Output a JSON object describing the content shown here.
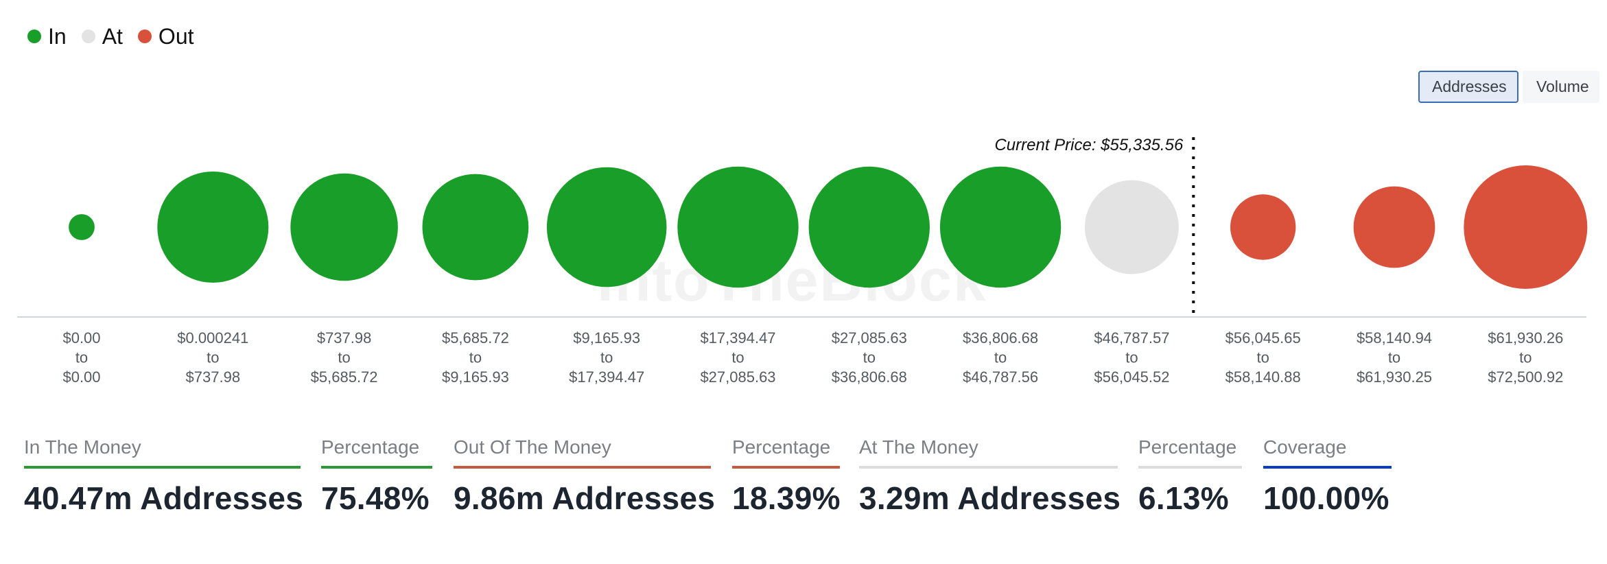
{
  "legend": [
    {
      "label": "In",
      "color": "#1a9e2a"
    },
    {
      "label": "At",
      "color": "#e3e3e3"
    },
    {
      "label": "Out",
      "color": "#d9513a"
    }
  ],
  "toggle": {
    "addresses_label": "Addresses",
    "volume_label": "Volume",
    "selected": "Addresses"
  },
  "watermark": "IntoTheBlock",
  "chart_data": {
    "type": "bubble",
    "title": "",
    "current_price_label": "Current Price: $55,335.56",
    "current_price": 55335.56,
    "categories": [
      {
        "from": "$0.00",
        "to": "$0.00",
        "status": "In",
        "relative_size": 0.21
      },
      {
        "from": "$0.000241",
        "to": "$737.98",
        "status": "In",
        "relative_size": 0.9
      },
      {
        "from": "$737.98",
        "to": "$5,685.72",
        "status": "In",
        "relative_size": 0.87
      },
      {
        "from": "$5,685.72",
        "to": "$9,165.93",
        "status": "In",
        "relative_size": 0.86
      },
      {
        "from": "$9,165.93",
        "to": "$17,394.47",
        "status": "In",
        "relative_size": 0.97
      },
      {
        "from": "$17,394.47",
        "to": "$27,085.63",
        "status": "In",
        "relative_size": 0.98
      },
      {
        "from": "$27,085.63",
        "to": "$36,806.68",
        "status": "In",
        "relative_size": 0.98
      },
      {
        "from": "$36,806.68",
        "to": "$46,787.56",
        "status": "In",
        "relative_size": 0.98
      },
      {
        "from": "$46,787.57",
        "to": "$56,045.52",
        "status": "At",
        "relative_size": 0.76
      },
      {
        "from": "$56,045.65",
        "to": "$58,140.88",
        "status": "Out",
        "relative_size": 0.53
      },
      {
        "from": "$58,140.94",
        "to": "$61,930.25",
        "status": "Out",
        "relative_size": 0.66
      },
      {
        "from": "$61,930.26",
        "to": "$72,500.92",
        "status": "Out",
        "relative_size": 1.0
      }
    ],
    "range_joiner": "to",
    "current_price_after_index": 8.47,
    "colors": {
      "In": "#1a9e2a",
      "At": "#e3e3e3",
      "Out": "#d9513a"
    }
  },
  "stats": [
    {
      "label": "In The Money",
      "value": "40.47m Addresses",
      "bar_color": "#2b9a36"
    },
    {
      "label": "Percentage",
      "value": "75.48%",
      "bar_color": "#2b9a36"
    },
    {
      "label": "Out Of The Money",
      "value": "9.86m Addresses",
      "bar_color": "#c45a3f"
    },
    {
      "label": "Percentage",
      "value": "18.39%",
      "bar_color": "#c45a3f"
    },
    {
      "label": "At The Money",
      "value": "3.29m Addresses",
      "bar_color": "#dcdcdc"
    },
    {
      "label": "Percentage",
      "value": "6.13%",
      "bar_color": "#dcdcdc"
    },
    {
      "label": "Coverage",
      "value": "100.00%",
      "bar_color": "#0a3cc4"
    }
  ]
}
